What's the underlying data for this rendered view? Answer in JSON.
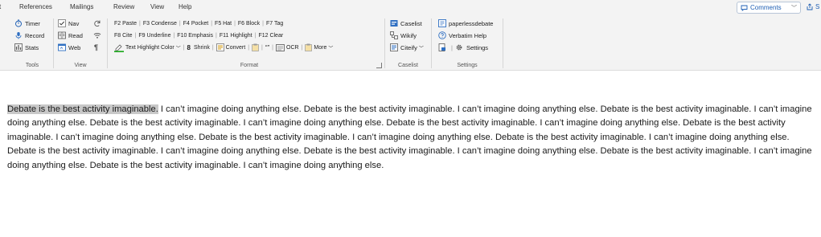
{
  "tabs": [
    "t",
    "References",
    "Mailings",
    "Review",
    "View",
    "Help"
  ],
  "comments_label": "Comments",
  "share_label": "S",
  "groups": {
    "tools": {
      "label": "Tools",
      "items": [
        "Timer",
        "Record",
        "Stats"
      ]
    },
    "view": {
      "label": "View",
      "items": [
        "Nav",
        "Read",
        "Web"
      ]
    },
    "format": {
      "label": "Format",
      "row1": [
        "F2 Paste",
        "F3 Condense",
        "F4 Pocket",
        "F5 Hat",
        "F6 Block",
        "F7 Tag"
      ],
      "row2": [
        "F8 Cite",
        "F9 Underline",
        "F10 Emphasis",
        "F11 Highlight",
        "F12 Clear"
      ],
      "row3": {
        "highlight_color": "Text Highlight Color",
        "shrink_key": "8",
        "shrink": "Shrink",
        "convert": "Convert",
        "quote": "“”",
        "ocr": "OCR",
        "more": "More"
      }
    },
    "caselist": {
      "label": "Caselist",
      "items": [
        "Caselist",
        "Wikify",
        "Citeify"
      ]
    },
    "settings": {
      "label": "Settings",
      "items": [
        "paperlessdebate",
        "Verbatim Help",
        "Settings"
      ]
    }
  },
  "colors": {
    "highlight": "#c8c8c8",
    "accent": "#1f5fb4",
    "highlight_pen": "#22aa22"
  },
  "icons": {
    "timer": "stopwatch-icon",
    "record": "microphone-icon",
    "stats": "stats-icon",
    "nav": "checkbox-icon",
    "read": "read-icon",
    "web": "web-icon",
    "settings": "gear-icon"
  },
  "document": {
    "highlighted": "Debate is the best activity imaginable.",
    "text": " I can’t imagine doing anything else. Debate is the best activity imaginable. I can’t imagine doing anything else. Debate is the best activity imaginable. I can’t imagine doing anything else. Debate is the best activity imaginable. I can’t imagine doing anything else. Debate is the best activity imaginable. I can’t imagine doing anything else. Debate is the best activity imaginable. I can’t imagine doing anything else. Debate is the best activity imaginable. I can’t imagine doing anything else. Debate is the best activity imaginable. I can’t imagine doing anything else. Debate is the best activity imaginable. I can’t imagine doing anything else. Debate is the best activity imaginable. I can’t imagine doing anything else. Debate is the best activity imaginable. I can’t imagine doing anything else. Debate is the best activity imaginable. I can’t imagine doing anything else."
  }
}
